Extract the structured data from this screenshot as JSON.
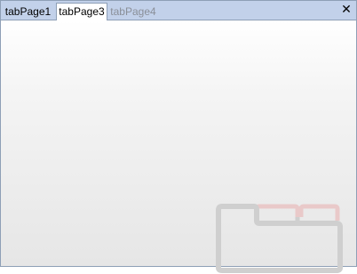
{
  "tabs": [
    {
      "label": "tabPage1",
      "state": "inactive"
    },
    {
      "label": "tabPage3",
      "state": "selected"
    },
    {
      "label": "tabPage4",
      "state": "disabled"
    }
  ],
  "close_icon": "close-icon",
  "watermark_icon": "tab-folders-icon",
  "colors": {
    "tabstrip": "#c2d1ea",
    "border": "#8e9fb6",
    "disabled_text": "#8a8f98",
    "watermark_gray": "#cfcfcf",
    "watermark_red": "#e9c9c9"
  }
}
